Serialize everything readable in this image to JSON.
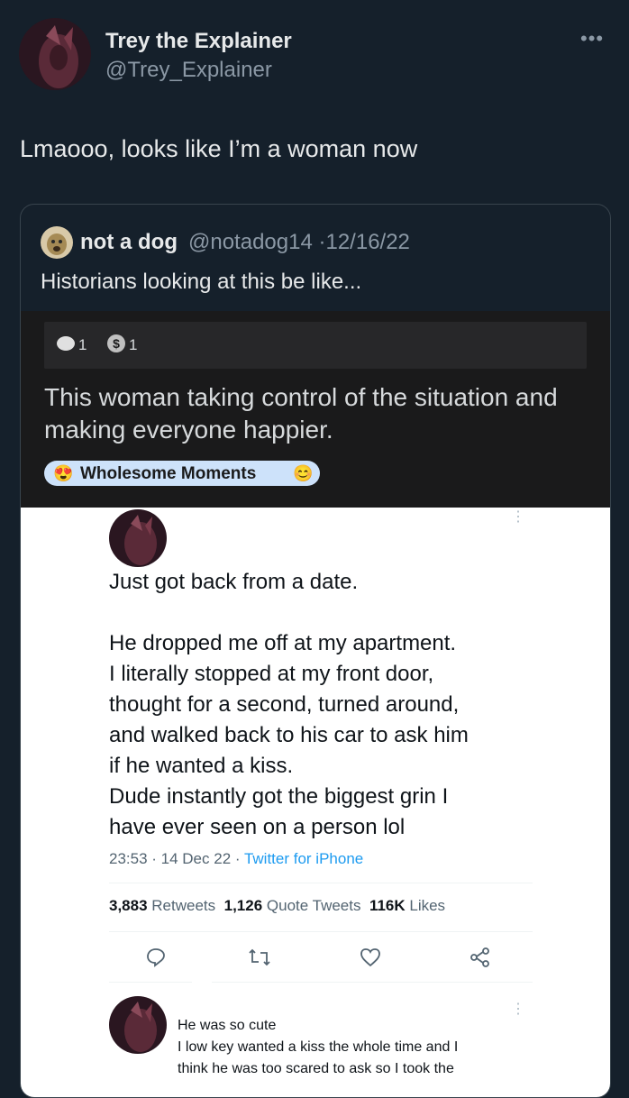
{
  "author": {
    "name": "Trey the Explainer",
    "handle": "@Trey_Explainer",
    "more_icon": "more-dots-icon"
  },
  "tweet": {
    "text": "Lmaooo, looks like I’m a woman now"
  },
  "quote": {
    "name": "not a dog",
    "handle": "@notadog14",
    "separator": "·",
    "date": "12/16/22",
    "text": "Historians looking at this be like..."
  },
  "reddit": {
    "award1_count": "1",
    "award2_count": "1",
    "title": "This woman taking control of the situation and making everyone happier.",
    "flair": "Wholesome Moments",
    "colors": {
      "background": "#1a1a1b",
      "flair": "#cde2fa"
    }
  },
  "screenshot": {
    "text": "Just got back from a date.\n\nHe dropped me off at my apartment.\nI literally stopped at my front door,\nthought for a second, turned around,\nand walked back to his car to ask him\nif he wanted a kiss.\nDude instantly got the biggest grin I\nhave ever seen on a person lol",
    "time": "23:53 · 14 Dec 22 · ",
    "source": "Twitter for iPhone",
    "retweets_count": "3,883",
    "retweets_label": "Retweets",
    "quotes_count": "1,126",
    "quotes_label": "Quote Tweets",
    "likes_count": "116K",
    "likes_label": "Likes",
    "reply_line1": "He was so cute",
    "reply_line2": "I low key wanted a kiss the whole time and I",
    "reply_line3": "think he was too scared to ask so I took the"
  }
}
